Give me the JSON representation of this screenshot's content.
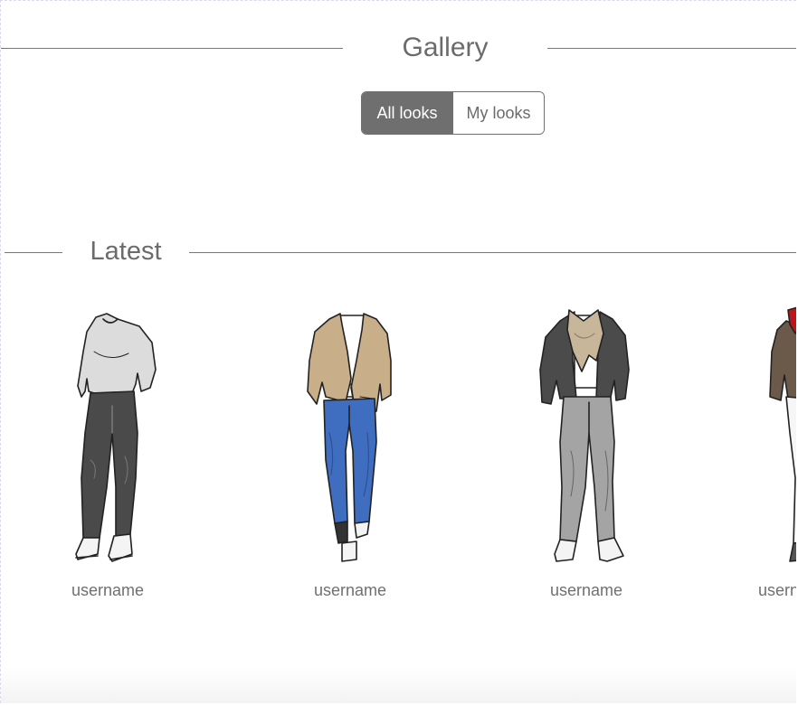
{
  "gallery": {
    "title": "Gallery",
    "tabs": [
      {
        "label": "All looks",
        "active": true
      },
      {
        "label": "My looks",
        "active": false
      }
    ]
  },
  "latest": {
    "title": "Latest",
    "looks": [
      {
        "username": "username",
        "outfit": "grey sweater, dark grey jeans, white sneakers"
      },
      {
        "username": "username",
        "outfit": "beige blazer, white tee, blue jeans"
      },
      {
        "username": "username",
        "outfit": "dark grey blazer, beige scarf, grey trousers"
      },
      {
        "username": "username",
        "outfit": "brown jacket, red scarf, white trousers"
      }
    ]
  },
  "colors": {
    "accent": "#6f6f6f",
    "text": "#666666",
    "rule": "#777777"
  }
}
